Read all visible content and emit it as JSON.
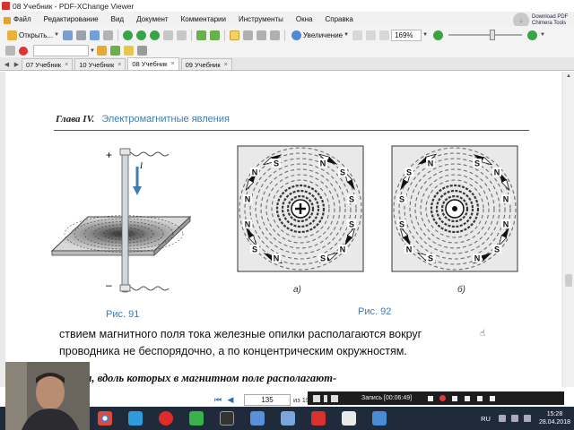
{
  "window": {
    "title": "08 Учебник - PDF-XChange Viewer"
  },
  "menu": [
    "Файл",
    "Редактирование",
    "Вид",
    "Документ",
    "Комментарии",
    "Инструменты",
    "Окна",
    "Справка"
  ],
  "promo": {
    "line1": "Download PDF",
    "line2": "Chimera Tools"
  },
  "toolbar": {
    "open_label": "Открыть...",
    "zoom_label": "Увеличение",
    "zoom_value": "169%",
    "zoom_slider_fraction": 0.6
  },
  "tabs": [
    {
      "label": "07 Учебник",
      "active": false
    },
    {
      "label": "10 Учебник",
      "active": false
    },
    {
      "label": "08 Учебник",
      "active": true
    },
    {
      "label": "09 Учебник",
      "active": false
    }
  ],
  "page": {
    "chapter": "Глава IV.",
    "section": "Электромагнитные явления",
    "fig91": {
      "plus": "+",
      "minus": "–",
      "current": "I",
      "caption": "Рис. 91"
    },
    "fig92": {
      "caption": "Рис. 92",
      "a_label": "а)",
      "b_label": "б)",
      "a_poles": [
        "S",
        "N",
        "N",
        "S",
        "N",
        "S",
        "N",
        "S",
        "S",
        "N",
        "N",
        "S"
      ],
      "b_poles": [
        "N",
        "S",
        "S",
        "N",
        "S",
        "N",
        "S",
        "N",
        "N",
        "S",
        "S",
        "N"
      ]
    },
    "line1": "ствием магнитного поля тока железные опилки располагаются вокруг",
    "line2": "проводника не беспорядочно, а по концентрическим окружностям.",
    "line3": "Линии, вдоль которых в магнитном поле располагают-"
  },
  "navigation": {
    "current_page": "135",
    "page_count": "из 196"
  },
  "recorder": {
    "label": "Запись [00:06:49]"
  },
  "taskbar": {
    "lang": "RU",
    "time": "15:28",
    "date": "28.04.2018"
  },
  "colors": {
    "accent": "#3e7cb1",
    "taskbar": "#1f2a3a",
    "record": "#e5393a"
  }
}
